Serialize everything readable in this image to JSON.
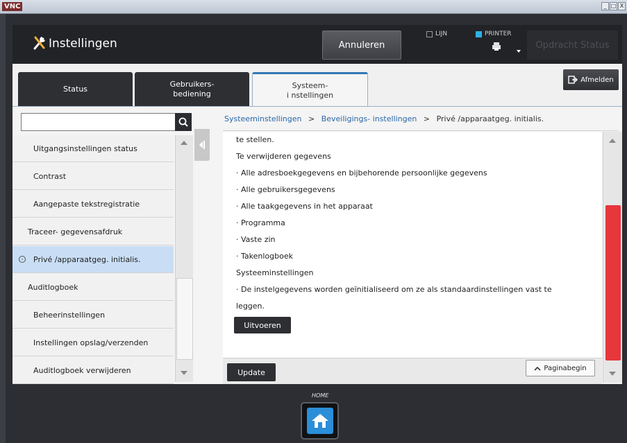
{
  "window": {
    "app_label": "VNC",
    "controls": [
      "_",
      "□",
      "X"
    ]
  },
  "header": {
    "title": "Instellingen",
    "cancel_label": "Annuleren",
    "status_lijn": "LIJN",
    "status_printer": "PRINTER",
    "job_status_label": "Opdracht Status"
  },
  "tabs": [
    {
      "label": "Status"
    },
    {
      "label": "Gebruikers-\nbediening"
    },
    {
      "label": "Systeem-\ni nstellingen"
    }
  ],
  "logout_label": "Afmelden",
  "search": {
    "value": "",
    "icon": "search-icon"
  },
  "breadcrumb": {
    "part1": "Systeeminstellingen",
    "sep": ">",
    "part2": "Beveiligings- instellingen",
    "part3": "Privé /apparaatgeg. initialis."
  },
  "nav": {
    "items": [
      {
        "label": "Uitgangsinstellingen status",
        "indent": 1
      },
      {
        "label": "Contrast",
        "indent": 1
      },
      {
        "label": "Aangepaste tekstregistratie",
        "indent": 1
      },
      {
        "label": "Traceer- gegevensafdruk",
        "indent": 0
      },
      {
        "label": "Privé /apparaatgeg. initialis.",
        "indent": 0,
        "selected": true
      },
      {
        "label": "Auditlogboek",
        "indent": 0
      },
      {
        "label": "Beheerinstellingen",
        "indent": 1
      },
      {
        "label": "Instellingen opslag/verzenden",
        "indent": 1
      },
      {
        "label": "Auditlogboek verwijderen",
        "indent": 1
      }
    ]
  },
  "content": {
    "lines": [
      "te stellen.",
      "Te verwijderen gegevens",
      "· Alle adresboekgegevens en bijbehorende persoonlijke gegevens",
      "· Alle gebruikersgegevens",
      "· Alle taakgegevens in het apparaat",
      "· Programma",
      "· Vaste zin",
      "· Takenlogboek",
      "Systeeminstellingen",
      "· De instelgegevens worden geïnitialiseerd om ze als standaardinstellingen vast te",
      "leggen."
    ],
    "execute_label": "Uitvoeren"
  },
  "footer": {
    "update_label": "Update",
    "top_label": "Paginabegin"
  },
  "home_label": "HOME",
  "colors": {
    "accent": "#2f78b4",
    "scroll_thumb": "#e8363d",
    "printer_on": "#2fb0e4",
    "home_blue": "#2b8ed8"
  }
}
